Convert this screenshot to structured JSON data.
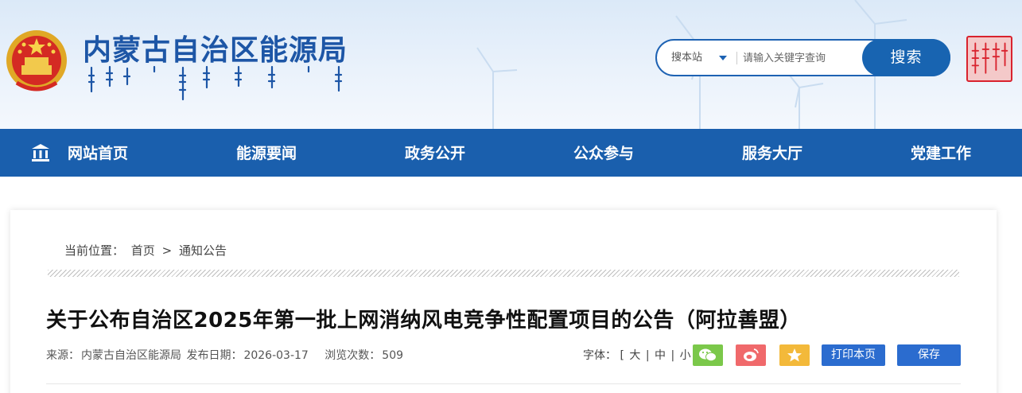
{
  "header": {
    "site_title": "内蒙古自治区能源局",
    "emblem_icon": "national-emblem-icon",
    "seal_icon": "inner-mongolia-seal-icon",
    "mongolian_script_icon": "mongolian-script-subtitle"
  },
  "search": {
    "scope_label": "搜本站",
    "placeholder": "请输入关键字查询",
    "button_label": "搜索"
  },
  "nav": {
    "items": [
      {
        "label": "网站首页",
        "icon": "home-icon"
      },
      {
        "label": "能源要闻"
      },
      {
        "label": "政务公开"
      },
      {
        "label": "公众参与"
      },
      {
        "label": "服务大厅"
      },
      {
        "label": "党建工作"
      }
    ]
  },
  "breadcrumb": {
    "prefix": "当前位置：",
    "home": "首页",
    "separator": ">",
    "current": "通知公告"
  },
  "article": {
    "title": "关于公布自治区2025年第一批上网消纳风电竞争性配置项目的公告（阿拉善盟）",
    "source_label": "来源：",
    "source": "内蒙古自治区能源局",
    "date_label": "发布日期：",
    "date": "2026-03-17",
    "views_label": "浏览次数：",
    "views": "509"
  },
  "tools": {
    "font_label": "字体：",
    "open_bracket": "[",
    "large": "大",
    "sep1": "|",
    "medium": "中",
    "sep2": "|",
    "small": "小",
    "close_bracket": "]",
    "share_icons": [
      "wechat-icon",
      "weibo-icon",
      "favorite-star-icon"
    ],
    "print_label": "打印本页",
    "save_label": "保存"
  },
  "colors": {
    "primary_blue": "#1a5fad",
    "wechat_green": "#7bc84a",
    "weibo_red": "#f0696b",
    "star_yellow": "#f3b93a",
    "button_blue": "#2b6ccf"
  }
}
